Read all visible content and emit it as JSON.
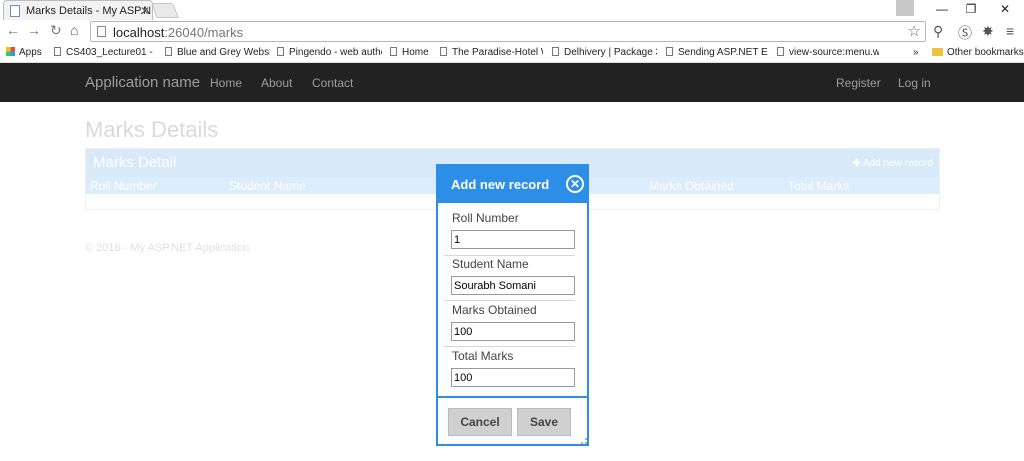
{
  "browser": {
    "tab_title": "Marks Details - My ASP.N",
    "url_host": "localhost",
    "url_path": ":26040/marks",
    "window_controls": [
      "—",
      "❐",
      "✕"
    ],
    "bookmarks": [
      "Apps",
      "CS403_Lecture01 - Yo",
      "Blue and Grey Websit",
      "Pingendo - web autho",
      "Home",
      "The Paradise-Hotel W",
      "Delhivery | Package 30",
      "Sending ASP.NET Ema",
      "view-source:menu.wa",
      "»",
      "Other bookmarks"
    ]
  },
  "navbar": {
    "brand": "Application name",
    "links": [
      "Home",
      "About",
      "Contact"
    ],
    "right_links": [
      "Register",
      "Log in"
    ]
  },
  "page": {
    "title": "Marks Details",
    "grid_title": "Marks Detail",
    "add_record": "Add new record",
    "columns": [
      "Roll Number",
      "Student Name",
      "Marks Obtained",
      "Total Marks"
    ],
    "footer": "© 2016 - My ASP.NET Application"
  },
  "modal": {
    "title": "Add new record",
    "fields": [
      {
        "label": "Roll Number",
        "value": "1"
      },
      {
        "label": "Student Name",
        "value": "Sourabh Somani"
      },
      {
        "label": "Marks Obtained",
        "value": "100"
      },
      {
        "label": "Total Marks",
        "value": "100"
      }
    ],
    "cancel_label": "Cancel",
    "save_label": "Save"
  },
  "colors": {
    "accent": "#2d8ee8",
    "navbar": "#222222"
  }
}
